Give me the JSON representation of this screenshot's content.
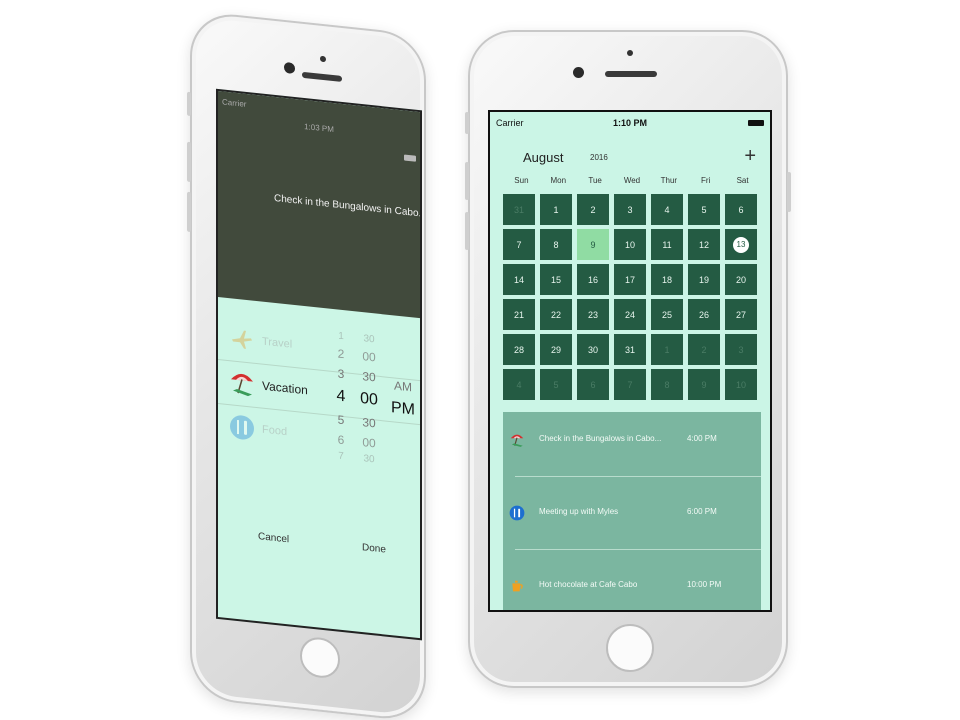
{
  "left_phone": {
    "status": {
      "carrier": "Carrier",
      "time": "1:03 PM"
    },
    "event_title": "Check in the Bungalows in Cabo...",
    "categories": [
      {
        "label": "Travel",
        "icon": "airplane-icon"
      },
      {
        "label": "Vacation",
        "icon": "beach-umbrella-icon"
      },
      {
        "label": "Food",
        "icon": "fork-knife-icon"
      }
    ],
    "time_picker": {
      "hours": [
        "1",
        "2",
        "3",
        "4",
        "5",
        "6",
        "7"
      ],
      "minutes": [
        "30",
        "00",
        "30",
        "00",
        "30",
        "00",
        "30"
      ],
      "selected_hour": "4",
      "selected_minute": "00",
      "meridiem": [
        "AM",
        "PM"
      ],
      "selected_meridiem": "PM"
    },
    "cancel_label": "Cancel",
    "done_label": "Done"
  },
  "right_phone": {
    "status": {
      "carrier": "Carrier",
      "time": "1:10 PM"
    },
    "calendar": {
      "month": "August",
      "year": "2016",
      "add_label": "+",
      "weekdays": [
        "Sun",
        "Mon",
        "Tue",
        "Wed",
        "Thur",
        "Fri",
        "Sat"
      ],
      "days": [
        {
          "n": "31",
          "dim": true
        },
        {
          "n": "1"
        },
        {
          "n": "2"
        },
        {
          "n": "3"
        },
        {
          "n": "4"
        },
        {
          "n": "5"
        },
        {
          "n": "6"
        },
        {
          "n": "7"
        },
        {
          "n": "8"
        },
        {
          "n": "9",
          "selected": true
        },
        {
          "n": "10"
        },
        {
          "n": "11"
        },
        {
          "n": "12"
        },
        {
          "n": "13",
          "today": true
        },
        {
          "n": "14"
        },
        {
          "n": "15"
        },
        {
          "n": "16"
        },
        {
          "n": "17"
        },
        {
          "n": "18"
        },
        {
          "n": "19"
        },
        {
          "n": "20"
        },
        {
          "n": "21"
        },
        {
          "n": "22"
        },
        {
          "n": "23"
        },
        {
          "n": "24"
        },
        {
          "n": "25"
        },
        {
          "n": "26"
        },
        {
          "n": "27"
        },
        {
          "n": "28"
        },
        {
          "n": "29"
        },
        {
          "n": "30"
        },
        {
          "n": "31"
        },
        {
          "n": "1",
          "dim": true
        },
        {
          "n": "2",
          "dim": true
        },
        {
          "n": "3",
          "dim": true
        },
        {
          "n": "4",
          "dim": true
        },
        {
          "n": "5",
          "dim": true
        },
        {
          "n": "6",
          "dim": true
        },
        {
          "n": "7",
          "dim": true
        },
        {
          "n": "8",
          "dim": true
        },
        {
          "n": "9",
          "dim": true
        },
        {
          "n": "10",
          "dim": true
        }
      ]
    },
    "events": [
      {
        "title": "Check in the Bungalows in Cabo...",
        "time": "4:00 PM",
        "icon": "beach-umbrella-icon"
      },
      {
        "title": "Meeting up with Myles",
        "time": "6:00 PM",
        "icon": "fork-knife-icon"
      },
      {
        "title": "Hot chocolate at Cafe Cabo",
        "time": "10:00 PM",
        "icon": "coffee-pot-icon"
      }
    ]
  },
  "colors": {
    "mint_bg": "#cbf5e6",
    "cell_green": "#245b43",
    "selected_cell": "#90dca3",
    "event_panel": "#7bb6a0",
    "editor_header": "#414a3c"
  }
}
